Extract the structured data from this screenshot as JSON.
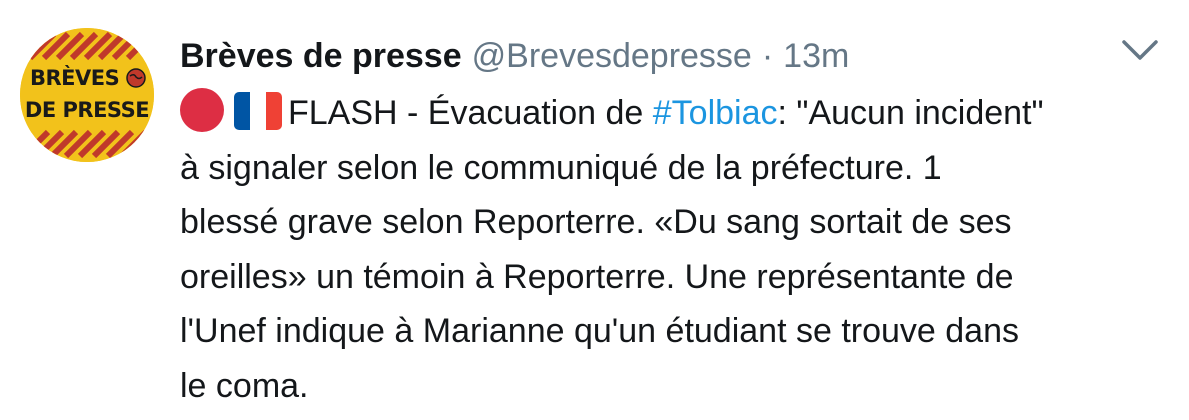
{
  "tweet": {
    "avatar": {
      "text_line1": "BRÈVES",
      "text_line2": "DE PRESSE"
    },
    "display_name": "Brèves de presse",
    "handle": "@Brevesdepresse",
    "separator": "·",
    "time": "13m",
    "emojis": [
      "red-circle",
      "flag-france"
    ],
    "colors": {
      "accent": "#1b95e0",
      "secondary_text": "#657786",
      "avatar_bg": "#f2c21b",
      "avatar_stripes": "#c0392b",
      "emoji_red": "#dd2e44",
      "flag_blue": "#0055a4",
      "flag_red": "#ef4135"
    },
    "text": {
      "line1_prefix": "FLASH - Évacuation de ",
      "hashtag": "#Tolbiac",
      "line1_suffix": ": \"Aucun incident\"",
      "line2": "à signaler selon le communiqué de la préfecture. 1",
      "line3": "blessé grave selon Reporterre. «Du sang sortait de ses",
      "line4": "oreilles» un témoin à Reporterre. Une représentante de",
      "line5": "l'Unef indique à Marianne qu'un étudiant se trouve dans",
      "line6": "le coma."
    }
  }
}
